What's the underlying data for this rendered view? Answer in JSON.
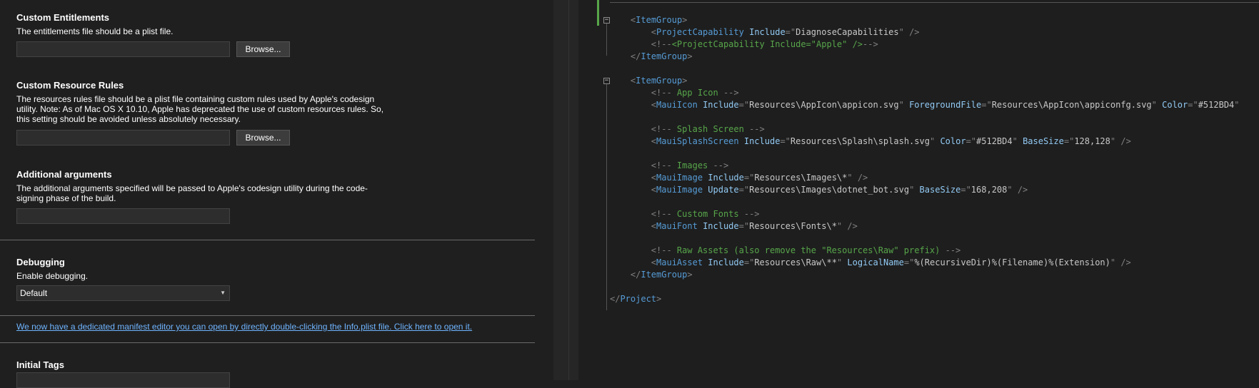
{
  "left_panel": {
    "custom_entitlements": {
      "title": "Custom Entitlements",
      "description": "The entitlements file should be a plist file.",
      "value": "",
      "browse_label": "Browse..."
    },
    "custom_resource_rules": {
      "title": "Custom Resource Rules",
      "description_lines": [
        "The resources rules file should be a plist file containing custom rules used by Apple's codesign",
        "utility. Note: As of Mac OS X 10.10, Apple has deprecated the use of custom resources rules. So,",
        "this setting should be avoided unless absolutely necessary."
      ],
      "value": "",
      "browse_label": "Browse..."
    },
    "additional_arguments": {
      "title": "Additional arguments",
      "description_lines": [
        "The additional arguments specified will be passed to Apple's codesign utility during the code-",
        "signing phase of the build."
      ],
      "value": ""
    },
    "debugging": {
      "title": "Debugging",
      "description": "Enable debugging.",
      "selected": "Default"
    },
    "manifest_link": "We now have a dedicated manifest editor you can open by directly double-clicking the Info.plist file. Click here to open it.",
    "initial_tags": {
      "title": "Initial Tags",
      "value": ""
    }
  },
  "editor": {
    "lines": [
      [
        {
          "t": "    "
        },
        {
          "c": "br",
          "t": "<"
        },
        {
          "c": "tg",
          "t": "ItemGroup"
        },
        {
          "c": "br",
          "t": ">"
        }
      ],
      [
        {
          "t": "        "
        },
        {
          "c": "br",
          "t": "<"
        },
        {
          "c": "tg",
          "t": "ProjectCapability"
        },
        {
          "t": " "
        },
        {
          "c": "at",
          "t": "Include"
        },
        {
          "c": "br",
          "t": "=\""
        },
        {
          "c": "vl",
          "t": "DiagnoseCapabilities"
        },
        {
          "c": "br",
          "t": "\" />"
        }
      ],
      [
        {
          "t": "        "
        },
        {
          "c": "br",
          "t": "<!--"
        },
        {
          "c": "cm",
          "t": "<ProjectCapability Include=\"Apple\" />"
        },
        {
          "c": "br",
          "t": "-->"
        }
      ],
      [
        {
          "t": "    "
        },
        {
          "c": "br",
          "t": "</"
        },
        {
          "c": "tg",
          "t": "ItemGroup"
        },
        {
          "c": "br",
          "t": ">"
        }
      ],
      [],
      [
        {
          "t": "    "
        },
        {
          "c": "br",
          "t": "<"
        },
        {
          "c": "tg",
          "t": "ItemGroup"
        },
        {
          "c": "br",
          "t": ">"
        }
      ],
      [
        {
          "t": "        "
        },
        {
          "c": "br",
          "t": "<!--"
        },
        {
          "c": "cm",
          "t": " App Icon "
        },
        {
          "c": "br",
          "t": "-->"
        }
      ],
      [
        {
          "t": "        "
        },
        {
          "c": "br",
          "t": "<"
        },
        {
          "c": "tg",
          "t": "MauiIcon"
        },
        {
          "t": " "
        },
        {
          "c": "at",
          "t": "Include"
        },
        {
          "c": "br",
          "t": "=\""
        },
        {
          "c": "vl",
          "t": "Resources\\AppIcon\\appicon.svg"
        },
        {
          "c": "br",
          "t": "\""
        },
        {
          "t": " "
        },
        {
          "c": "at",
          "t": "ForegroundFile"
        },
        {
          "c": "br",
          "t": "=\""
        },
        {
          "c": "vl",
          "t": "Resources\\AppIcon\\appiconfg.svg"
        },
        {
          "c": "br",
          "t": "\""
        },
        {
          "t": " "
        },
        {
          "c": "at",
          "t": "Color"
        },
        {
          "c": "br",
          "t": "=\""
        },
        {
          "c": "vl",
          "t": "#512BD4"
        },
        {
          "c": "br",
          "t": "\""
        }
      ],
      [],
      [
        {
          "t": "        "
        },
        {
          "c": "br",
          "t": "<!--"
        },
        {
          "c": "cm",
          "t": " Splash Screen "
        },
        {
          "c": "br",
          "t": "-->"
        }
      ],
      [
        {
          "t": "        "
        },
        {
          "c": "br",
          "t": "<"
        },
        {
          "c": "tg",
          "t": "MauiSplashScreen"
        },
        {
          "t": " "
        },
        {
          "c": "at",
          "t": "Include"
        },
        {
          "c": "br",
          "t": "=\""
        },
        {
          "c": "vl",
          "t": "Resources\\Splash\\splash.svg"
        },
        {
          "c": "br",
          "t": "\""
        },
        {
          "t": " "
        },
        {
          "c": "at",
          "t": "Color"
        },
        {
          "c": "br",
          "t": "=\""
        },
        {
          "c": "vl",
          "t": "#512BD4"
        },
        {
          "c": "br",
          "t": "\""
        },
        {
          "t": " "
        },
        {
          "c": "at",
          "t": "BaseSize"
        },
        {
          "c": "br",
          "t": "=\""
        },
        {
          "c": "vl",
          "t": "128,128"
        },
        {
          "c": "br",
          "t": "\" />"
        }
      ],
      [],
      [
        {
          "t": "        "
        },
        {
          "c": "br",
          "t": "<!--"
        },
        {
          "c": "cm",
          "t": " Images "
        },
        {
          "c": "br",
          "t": "-->"
        }
      ],
      [
        {
          "t": "        "
        },
        {
          "c": "br",
          "t": "<"
        },
        {
          "c": "tg",
          "t": "MauiImage"
        },
        {
          "t": " "
        },
        {
          "c": "at",
          "t": "Include"
        },
        {
          "c": "br",
          "t": "=\""
        },
        {
          "c": "vl",
          "t": "Resources\\Images\\*"
        },
        {
          "c": "br",
          "t": "\" />"
        }
      ],
      [
        {
          "t": "        "
        },
        {
          "c": "br",
          "t": "<"
        },
        {
          "c": "tg",
          "t": "MauiImage"
        },
        {
          "t": " "
        },
        {
          "c": "at",
          "t": "Update"
        },
        {
          "c": "br",
          "t": "=\""
        },
        {
          "c": "vl",
          "t": "Resources\\Images\\dotnet_bot.svg"
        },
        {
          "c": "br",
          "t": "\""
        },
        {
          "t": " "
        },
        {
          "c": "at",
          "t": "BaseSize"
        },
        {
          "c": "br",
          "t": "=\""
        },
        {
          "c": "vl",
          "t": "168,208"
        },
        {
          "c": "br",
          "t": "\" />"
        }
      ],
      [],
      [
        {
          "t": "        "
        },
        {
          "c": "br",
          "t": "<!--"
        },
        {
          "c": "cm",
          "t": " Custom Fonts "
        },
        {
          "c": "br",
          "t": "-->"
        }
      ],
      [
        {
          "t": "        "
        },
        {
          "c": "br",
          "t": "<"
        },
        {
          "c": "tg",
          "t": "MauiFont"
        },
        {
          "t": " "
        },
        {
          "c": "at",
          "t": "Include"
        },
        {
          "c": "br",
          "t": "=\""
        },
        {
          "c": "vl",
          "t": "Resources\\Fonts\\*"
        },
        {
          "c": "br",
          "t": "\" />"
        }
      ],
      [],
      [
        {
          "t": "        "
        },
        {
          "c": "br",
          "t": "<!--"
        },
        {
          "c": "cm",
          "t": " Raw Assets (also remove the \"Resources\\Raw\" prefix) "
        },
        {
          "c": "br",
          "t": "-->"
        }
      ],
      [
        {
          "t": "        "
        },
        {
          "c": "br",
          "t": "<"
        },
        {
          "c": "tg",
          "t": "MauiAsset"
        },
        {
          "t": " "
        },
        {
          "c": "at",
          "t": "Include"
        },
        {
          "c": "br",
          "t": "=\""
        },
        {
          "c": "vl",
          "t": "Resources\\Raw\\**"
        },
        {
          "c": "br",
          "t": "\""
        },
        {
          "t": " "
        },
        {
          "c": "at",
          "t": "LogicalName"
        },
        {
          "c": "br",
          "t": "=\""
        },
        {
          "c": "vl",
          "t": "%(RecursiveDir)%(Filename)%(Extension)"
        },
        {
          "c": "br",
          "t": "\" />"
        }
      ],
      [
        {
          "t": "    "
        },
        {
          "c": "br",
          "t": "</"
        },
        {
          "c": "tg",
          "t": "ItemGroup"
        },
        {
          "c": "br",
          "t": ">"
        }
      ],
      [],
      [
        {
          "c": "br",
          "t": "</"
        },
        {
          "c": "tg",
          "t": "Project"
        },
        {
          "c": "br",
          "t": ">"
        }
      ]
    ]
  }
}
